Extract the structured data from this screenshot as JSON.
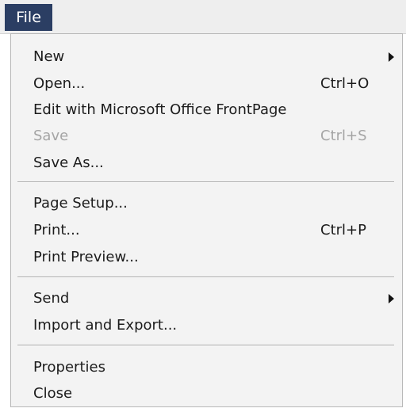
{
  "menubar": {
    "title": "File"
  },
  "menu": {
    "items": [
      {
        "label": "New",
        "shortcut": "",
        "submenu_icon": "chevron-right-icon",
        "enabled": true
      },
      {
        "label": "Open...",
        "shortcut": "Ctrl+O",
        "enabled": true
      },
      {
        "label": "Edit with Microsoft Office FrontPage",
        "shortcut": "",
        "enabled": true
      },
      {
        "label": "Save",
        "shortcut": "Ctrl+S",
        "enabled": false
      },
      {
        "label": "Save As...",
        "shortcut": "",
        "enabled": true
      },
      {
        "label": "Page Setup...",
        "shortcut": "",
        "enabled": true
      },
      {
        "label": "Print...",
        "shortcut": "Ctrl+P",
        "enabled": true
      },
      {
        "label": "Print Preview...",
        "shortcut": "",
        "enabled": true
      },
      {
        "label": "Send",
        "shortcut": "",
        "submenu_icon": "chevron-right-icon",
        "enabled": true
      },
      {
        "label": "Import and Export...",
        "shortcut": "",
        "enabled": true
      },
      {
        "label": "Properties",
        "shortcut": "",
        "enabled": true
      },
      {
        "label": "Close",
        "shortcut": "",
        "enabled": true
      }
    ]
  },
  "colors": {
    "menubar_bg": "#eeeeee",
    "title_bg": "#2b3e63",
    "menu_bg": "#f3f3f3",
    "text": "#1c1c1c",
    "disabled_text": "#a5a5a5"
  }
}
